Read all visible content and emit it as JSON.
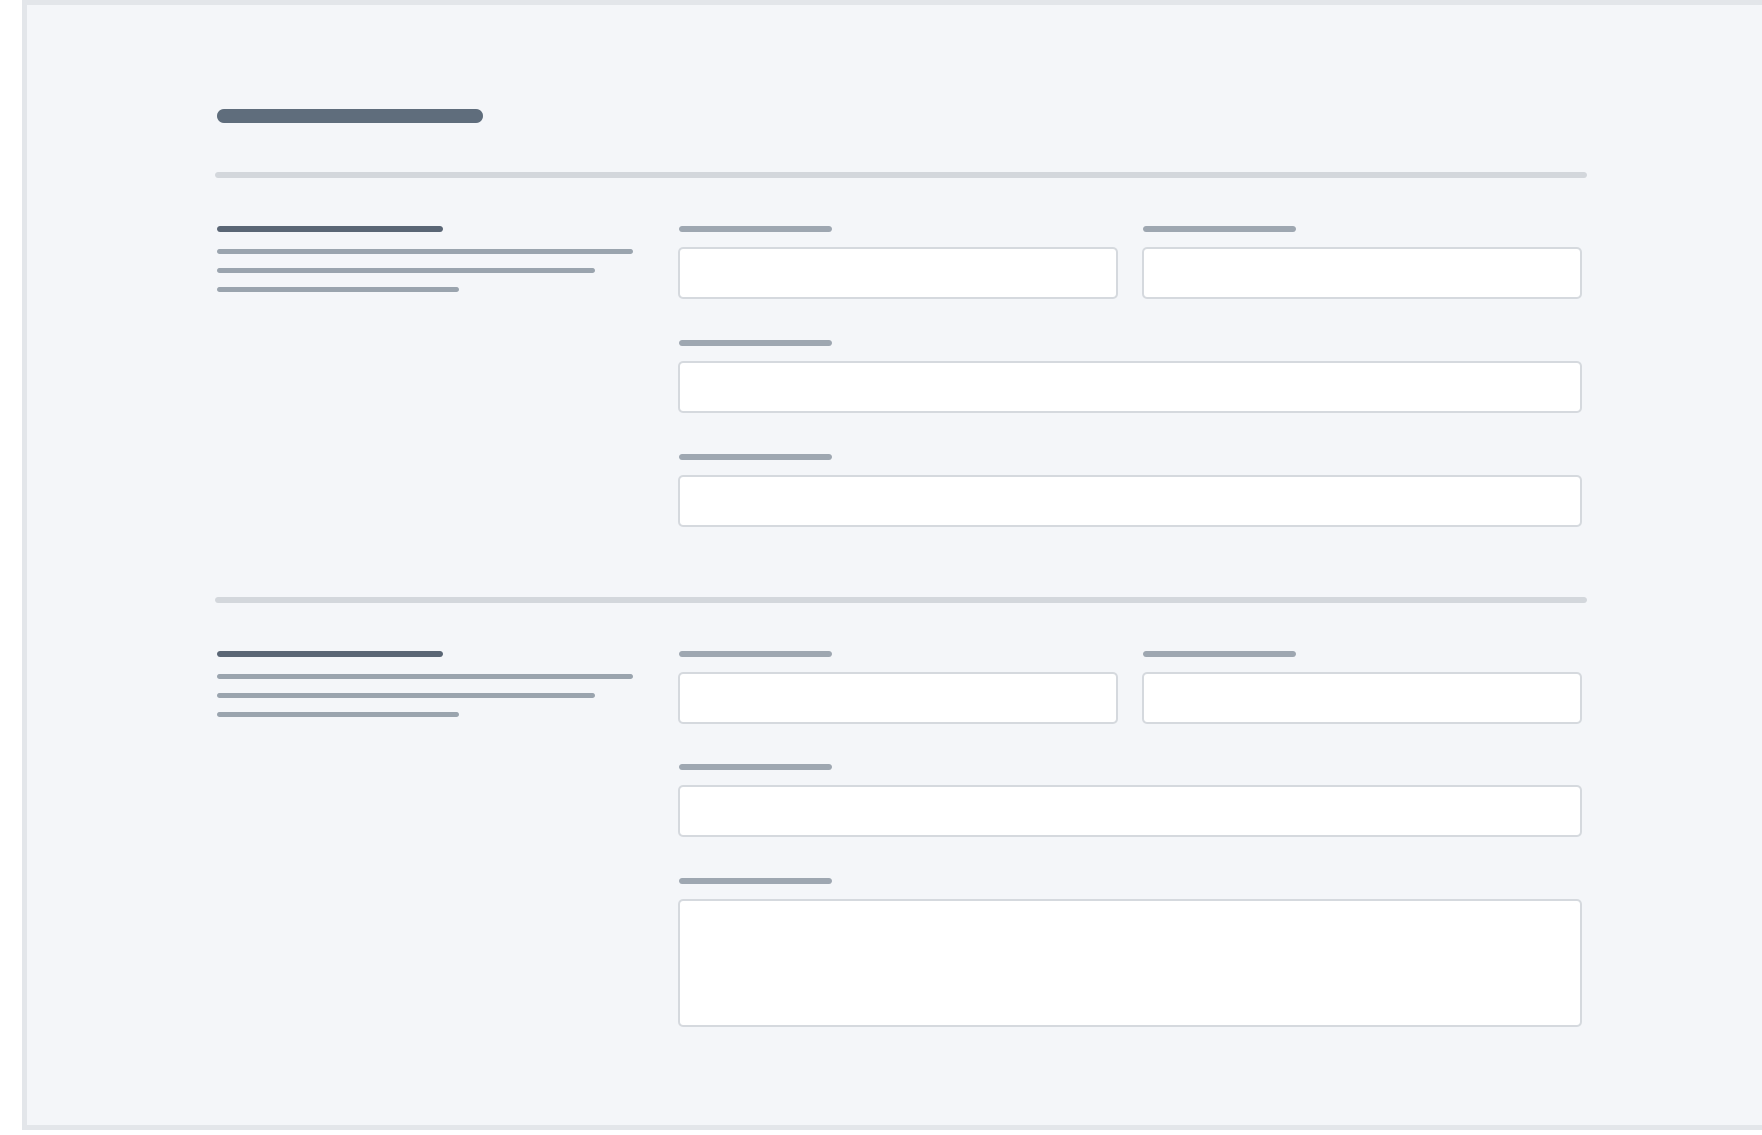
{
  "window": {
    "background": "#f4f6f9",
    "border": "#e3e6ea"
  },
  "form": {
    "title": "",
    "sections": [
      {
        "heading": "",
        "description": "",
        "fields": [
          {
            "label": "",
            "value": "",
            "type": "text"
          },
          {
            "label": "",
            "value": "",
            "type": "text"
          },
          {
            "label": "",
            "value": "",
            "type": "text"
          },
          {
            "label": "",
            "value": "",
            "type": "text"
          }
        ]
      },
      {
        "heading": "",
        "description": "",
        "fields": [
          {
            "label": "",
            "value": "",
            "type": "text"
          },
          {
            "label": "",
            "value": "",
            "type": "text"
          },
          {
            "label": "",
            "value": "",
            "type": "text"
          },
          {
            "label": "",
            "value": "",
            "type": "textarea"
          }
        ]
      }
    ]
  },
  "colors": {
    "placeholder_dark": "#5f6d7c",
    "placeholder_light": "#9ea7b1",
    "divider": "#d3d7dc",
    "input_border": "#d5d9de",
    "input_bg": "#ffffff"
  }
}
